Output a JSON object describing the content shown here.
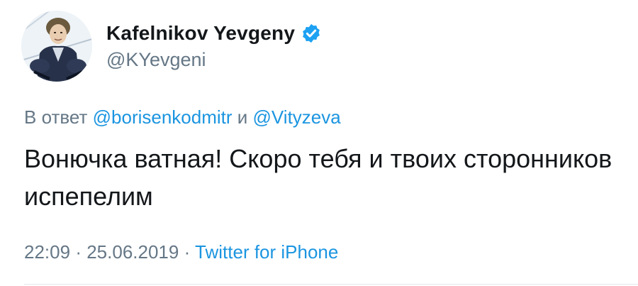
{
  "author": {
    "display_name": "Kafelnikov Yevgeny",
    "handle": "@KYevgeni",
    "verified_icon": "verified-badge-icon",
    "avatar_icon": "profile-avatar"
  },
  "reply": {
    "prefix": "В ответ",
    "mention_1": "@borisenkodmitr",
    "conjunction": "и",
    "mention_2": "@Vityzeva"
  },
  "tweet": {
    "text": "Вонючка ватная! Скоро тебя и твоих сторонников испепелим"
  },
  "meta": {
    "time": "22:09",
    "separator_1": "·",
    "date": "25.06.2019",
    "separator_2": "·",
    "source": "Twitter for iPhone"
  },
  "colors": {
    "text": "#14171a",
    "secondary": "#657786",
    "link": "#1b95e0",
    "verified": "#1da1f2",
    "divider": "#e1e8ed"
  }
}
